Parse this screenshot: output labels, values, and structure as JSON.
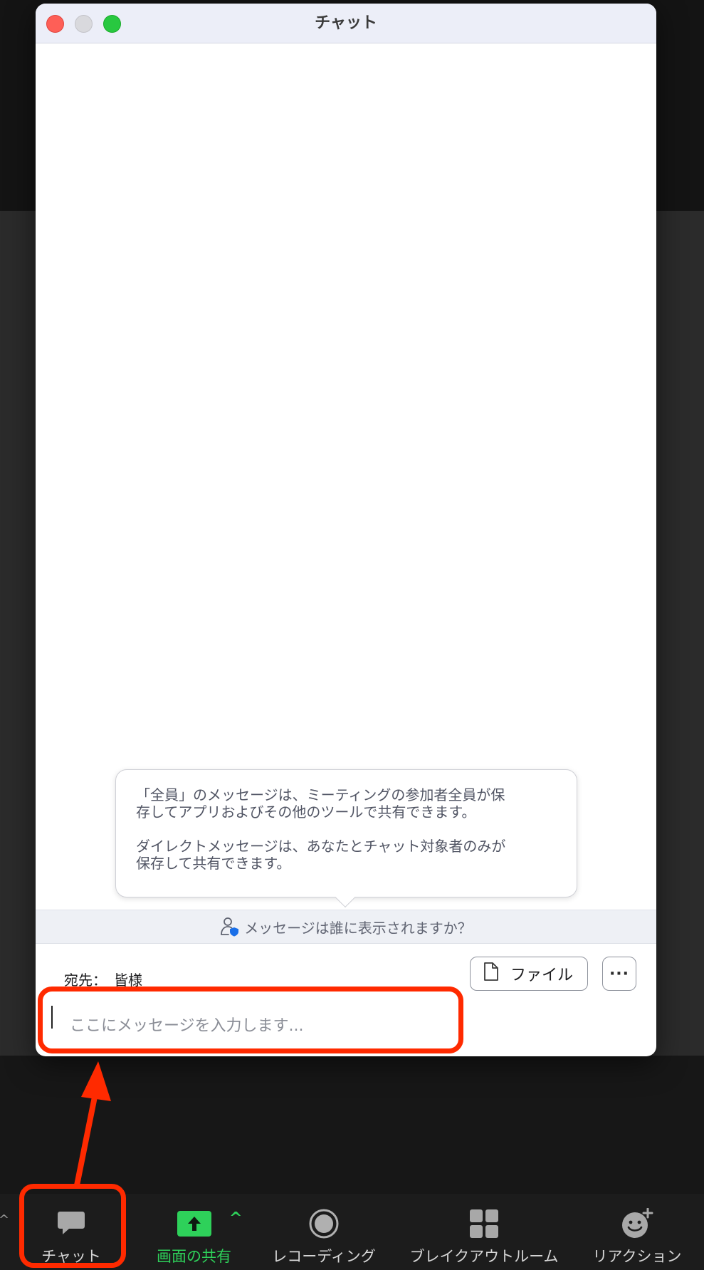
{
  "window": {
    "title": "チャット"
  },
  "tooltip": {
    "paragraph1": "「全員」のメッセージは、ミーティングの参加者全員が保\n存してアプリおよびその他のツールで共有できます。",
    "paragraph2": "ダイレクトメッセージは、あなたとチャット対象者のみが\n保存して共有できます。"
  },
  "visibility_bar": {
    "label": "メッセージは誰に表示されますか？"
  },
  "recipient": {
    "prefix": "宛先：",
    "value": "皆様"
  },
  "file_button": {
    "label": "ファイル"
  },
  "more_button": {
    "label": "···"
  },
  "compose": {
    "placeholder": "ここにメッセージを入力します..."
  },
  "toolbar": {
    "items": [
      {
        "label": "チャット",
        "icon": "chat-bubble-icon"
      },
      {
        "label": "画面の共有",
        "icon": "share-screen-icon"
      },
      {
        "label": "レコーディング",
        "icon": "record-icon"
      },
      {
        "label": "ブレイクアウトルーム",
        "icon": "breakout-rooms-icon"
      },
      {
        "label": "リアクション",
        "icon": "add-reaction-icon"
      }
    ],
    "edge_caret": "^",
    "share_caret": "^"
  },
  "colors": {
    "highlight": "#ff2a00",
    "share_green": "#2ed15a",
    "traffic_close": "#fe5f57",
    "traffic_min": "#d9d9dd",
    "traffic_max": "#28c840"
  }
}
